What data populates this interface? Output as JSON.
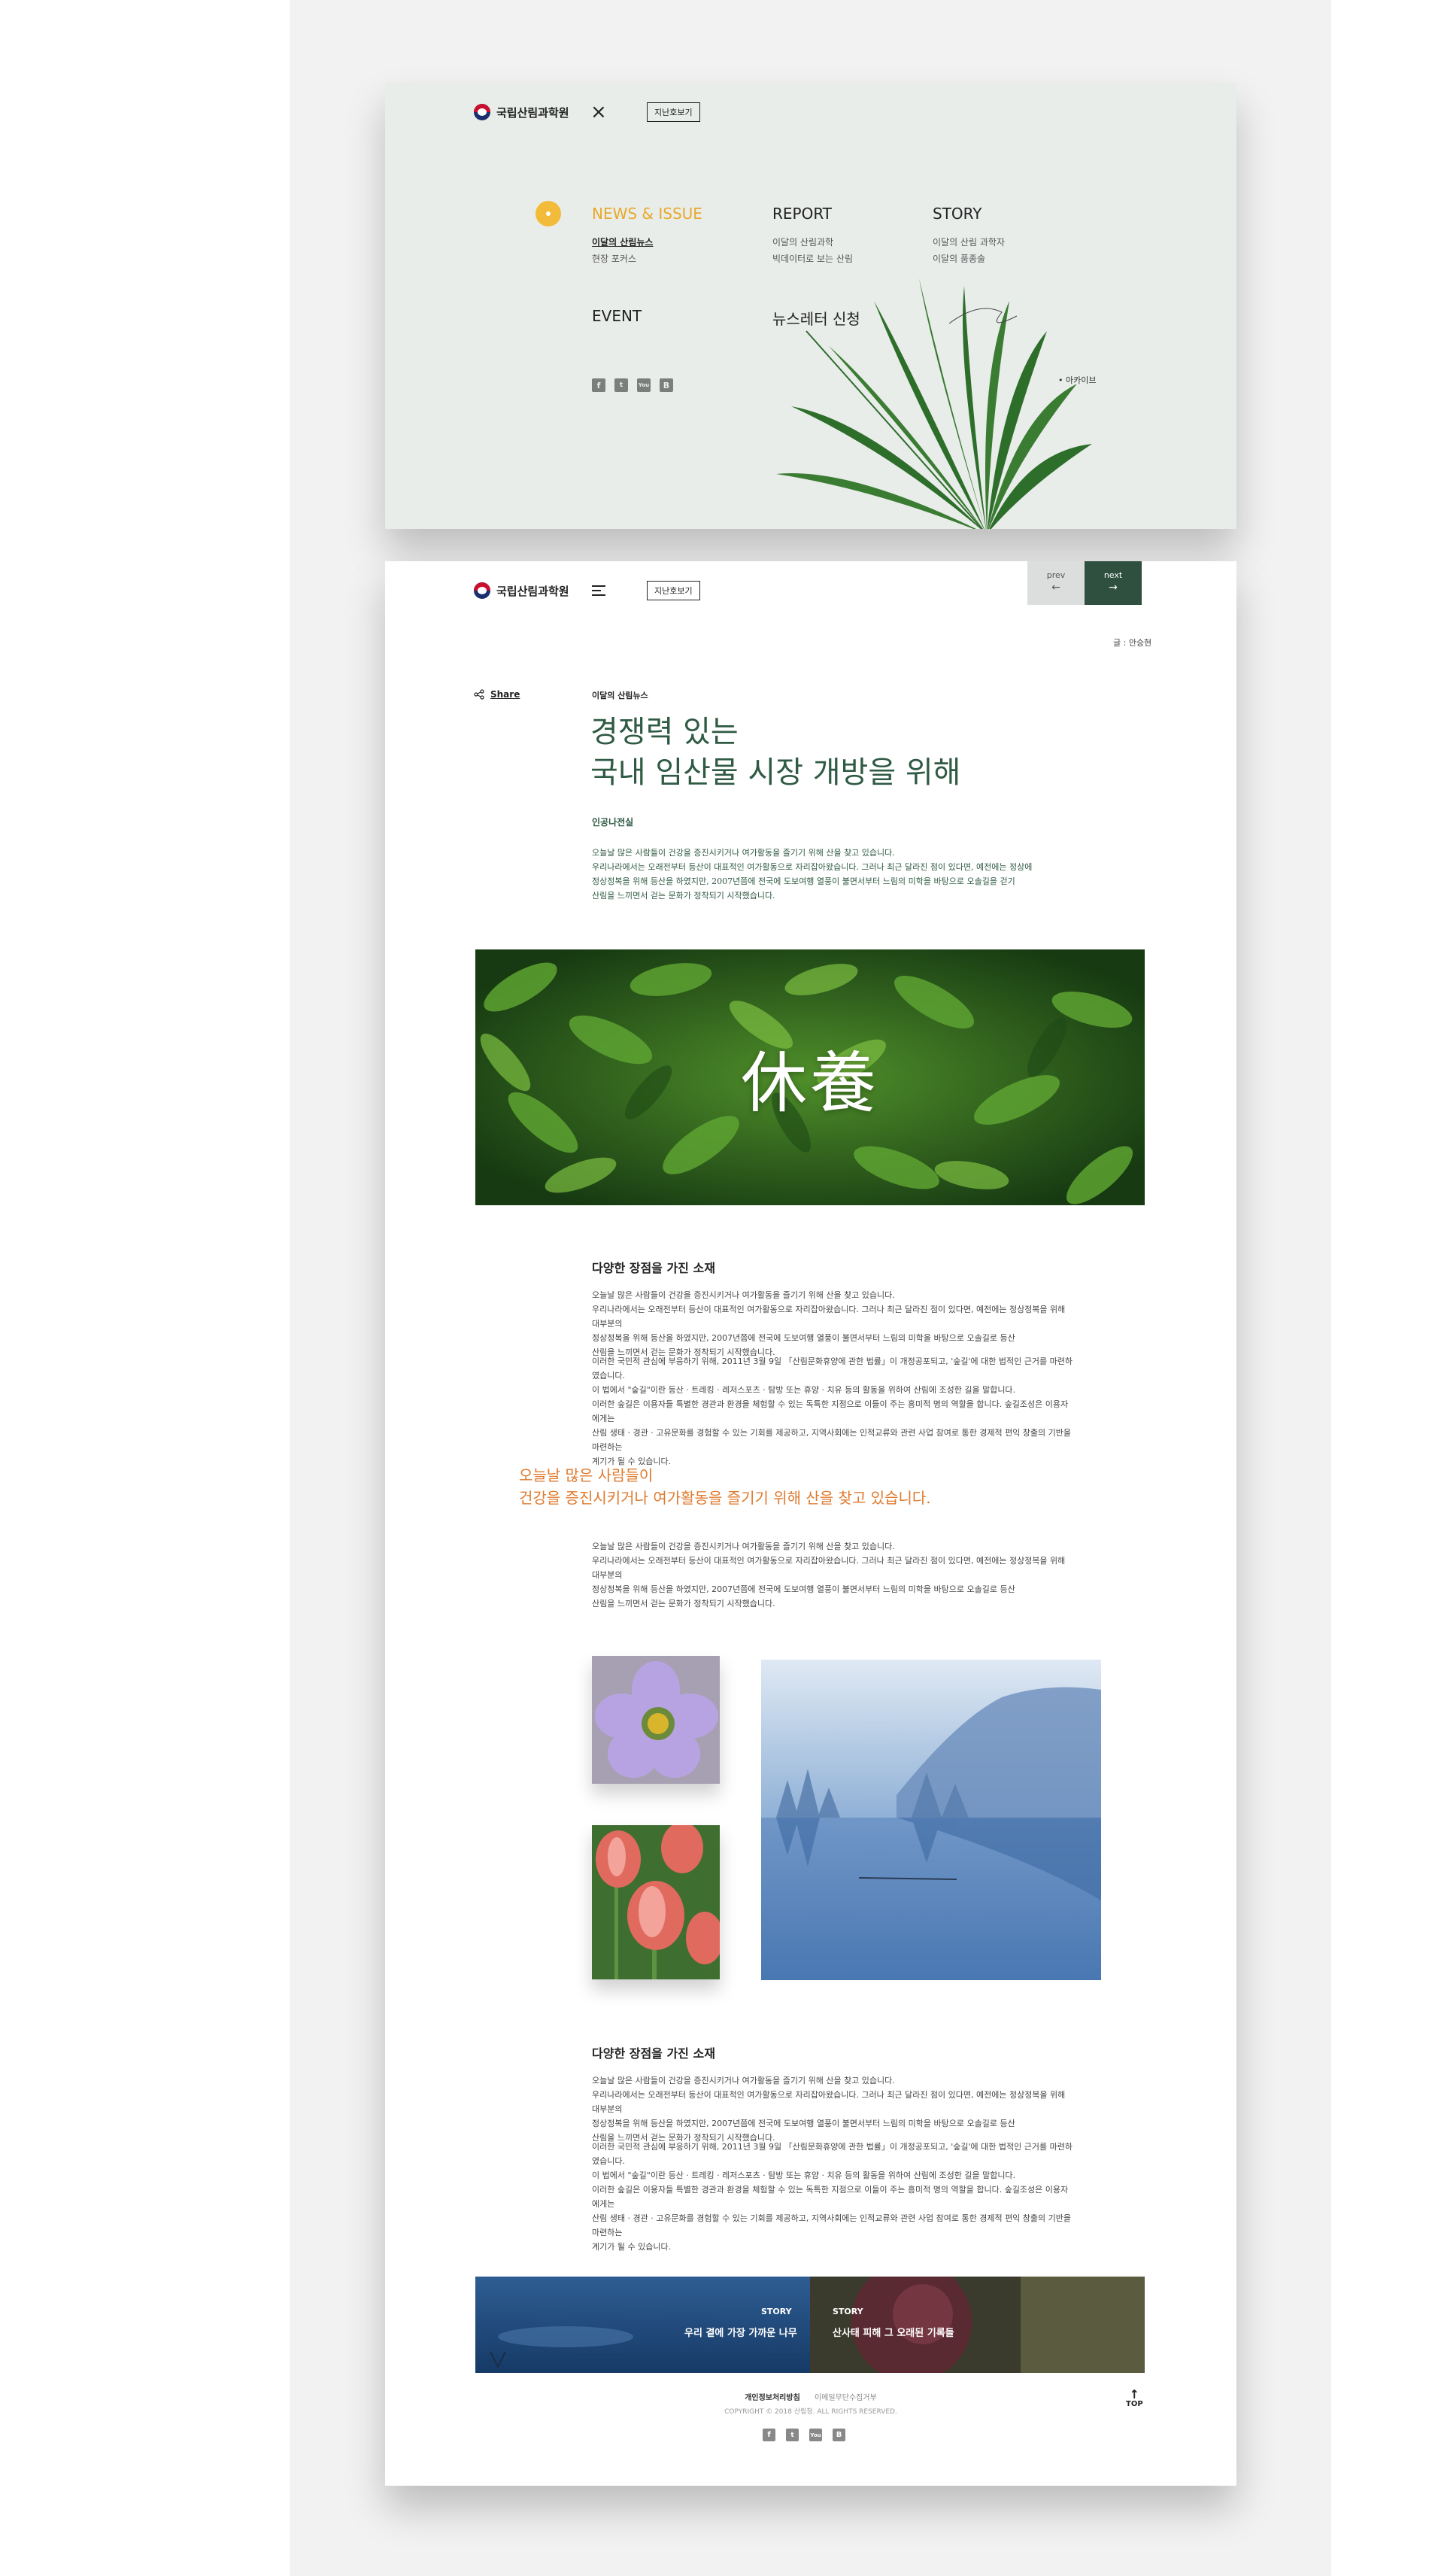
{
  "brand": {
    "name": "국립산림과학원"
  },
  "menu_panel": {
    "past_issues_label": "지난호보기",
    "sections": [
      {
        "heading": "NEWS & ISSUE",
        "items": [
          "이달의 산림뉴스",
          "현장 포커스"
        ]
      },
      {
        "heading": "REPORT",
        "items": [
          "이달의 산림과학",
          "빅데이터로 보는 산림"
        ]
      },
      {
        "heading": "STORY",
        "items": [
          "이달의 산림 과학자",
          "이달의 품종술"
        ]
      },
      {
        "heading": "EVENT",
        "items": []
      },
      {
        "heading": "뉴스레터 신청",
        "items": []
      }
    ],
    "social": [
      "f",
      "t",
      "You",
      "B"
    ],
    "archive_label": "• 아카이브",
    "colors": {
      "background": "#e9edea",
      "accent": "#f2bb3a"
    }
  },
  "article": {
    "past_issues_label": "지난호보기",
    "prev": {
      "label": "prev",
      "arrow": "←"
    },
    "next": {
      "label": "next",
      "arrow": "→"
    },
    "author": "글 : 안승현",
    "share_label": "Share",
    "category": "이달의 산림뉴스",
    "headline_line1": "경쟁력 있는",
    "headline_line2": "국내 임산물 시장 개방을 위해",
    "byline": "인공나전실",
    "lead": [
      "오늘날 많은 사람들이 건강을 증진시키거나 여가활동을 즐기기 위해 산을 찾고 있습니다.",
      "우리나라에서는 오래전부터 등산이 대표적인 여가활동으로 자리잡아왔습니다. 그러나 최근 달라진 점이 있다면, 예전에는 정상에",
      "정상정복을 위해 등산을 하였지만, 2007년쯤에 전국에 도보여행 열풍이 불면서부터 느림의 미학을 바탕으로 오솔길을 걷기",
      "산림을 느끼면서 걷는 문화가 정착되기 시작했습니다."
    ],
    "hero_caption": "休養",
    "section1": {
      "title": "다양한 장점을 가진 소재",
      "p1": [
        "오늘날 많은 사람들이 건강을 증진시키거나 여가활동을 즐기기 위해 산을 찾고 있습니다.",
        "우리나라에서는 오래전부터 등산이 대표적인 여가활동으로 자리잡아왔습니다. 그러나 최근 달라진 점이 있다면, 예전에는 정상정복을 위해 대부분의",
        "정상정복을 위해 등산을 하였지만, 2007년쯤에 전국에 도보여행 열풍이 불면서부터 느림의 미학을 바탕으로 오솔길로 등산",
        "산림을 느끼면서 걷는 문화가 정착되기 시작했습니다."
      ],
      "p2": [
        "이러한 국민적 관심에 부응하기 위해, 2011년 3월 9일 「산림문화휴양에 관한 법률」이 개정공포되고, '숲길'에 대한 법적인 근거를 마련하였습니다.",
        "이 법에서 \"숲길\"이란 등산 · 트레킹 · 레저스포츠 · 탐방 또는 휴양 · 치유 등의 활동을 위하여 산림에 조성한 길을 말합니다.",
        "이러한 숲길은 이용자들 특별한 경관과 환경을 체험할 수 있는 독특한 지점으로 이들이 주는 흥미적 명의 역할을 합니다. 숲길조성은 이용자에게는",
        "산림 생태 · 경관 · 고유문화를 경험할 수 있는 기회를 제공하고, 지역사회에는 인적교류와 관련 사업 참여로 통한 경제적 편익 창출의 기반을 마련하는",
        "계기가 될 수 있습니다."
      ]
    },
    "quote_line1": "오늘날 많은 사람들이",
    "quote_line2": "건강을 증진시키거나 여가활동을 즐기기 위해 산을 찾고 있습니다.",
    "quote_para": [
      "오늘날 많은 사람들이 건강을 증진시키거나 여가활동을 즐기기 위해 산을 찾고 있습니다.",
      "우리나라에서는 오래전부터 등산이 대표적인 여가활동으로 자리잡아왔습니다. 그러나 최근 달라진 점이 있다면, 예전에는 정상정복을 위해 대부분의",
      "정상정복을 위해 등산을 하였지만, 2007년쯤에 전국에 도보여행 열풍이 불면서부터 느림의 미학을 바탕으로 오솔길로 등산",
      "산림을 느끼면서 걷는 문화가 정착되기 시작했습니다."
    ],
    "section2": {
      "title": "다양한 장점을 가진 소재",
      "p1": [
        "오늘날 많은 사람들이 건강을 증진시키거나 여가활동을 즐기기 위해 산을 찾고 있습니다.",
        "우리나라에서는 오래전부터 등산이 대표적인 여가활동으로 자리잡아왔습니다. 그러나 최근 달라진 점이 있다면, 예전에는 정상정복을 위해 대부분의",
        "정상정복을 위해 등산을 하였지만, 2007년쯤에 전국에 도보여행 열풍이 불면서부터 느림의 미학을 바탕으로 오솔길로 등산",
        "산림을 느끼면서 걷는 문화가 정착되기 시작했습니다."
      ],
      "p2": [
        "이러한 국민적 관심에 부응하기 위해, 2011년 3월 9일 「산림문화휴양에 관한 법률」이 개정공포되고, '숲길'에 대한 법적인 근거를 마련하였습니다.",
        "이 법에서 \"숲길\"이란 등산 · 트레킹 · 레저스포츠 · 탐방 또는 휴양 · 치유 등의 활동을 위하여 산림에 조성한 길을 말합니다.",
        "이러한 숲길은 이용자들 특별한 경관과 환경을 체험할 수 있는 독특한 지점으로 이들이 주는 흥미적 명의 역할을 합니다. 숲길조성은 이용자에게는",
        "산림 생태 · 경관 · 고유문화를 경험할 수 있는 기회를 제공하고, 지역사회에는 인적교류와 관련 사업 참여로 통한 경제적 편익 창출의 기반을 마련하는",
        "계기가 될 수 있습니다."
      ]
    },
    "story_cards": [
      {
        "tag": "STORY",
        "title": "우리 곁에 가장 가까운 나무"
      },
      {
        "tag": "STORY",
        "title": "산사태 피해 그 오래된 기록들"
      }
    ],
    "footer": {
      "link1": "개인정보처리방침",
      "link2": "이메일무단수집거부",
      "copyright": "COPYRIGHT © 2018 산림청. ALL RIGHTS RESERVED.",
      "social": [
        "f",
        "t",
        "You",
        "B"
      ],
      "top_label": "TOP",
      "top_arrow": "↑"
    },
    "colors": {
      "headline": "#2f5a43",
      "quote": "#e07a2e",
      "next_bg": "#2f4f3f"
    }
  }
}
